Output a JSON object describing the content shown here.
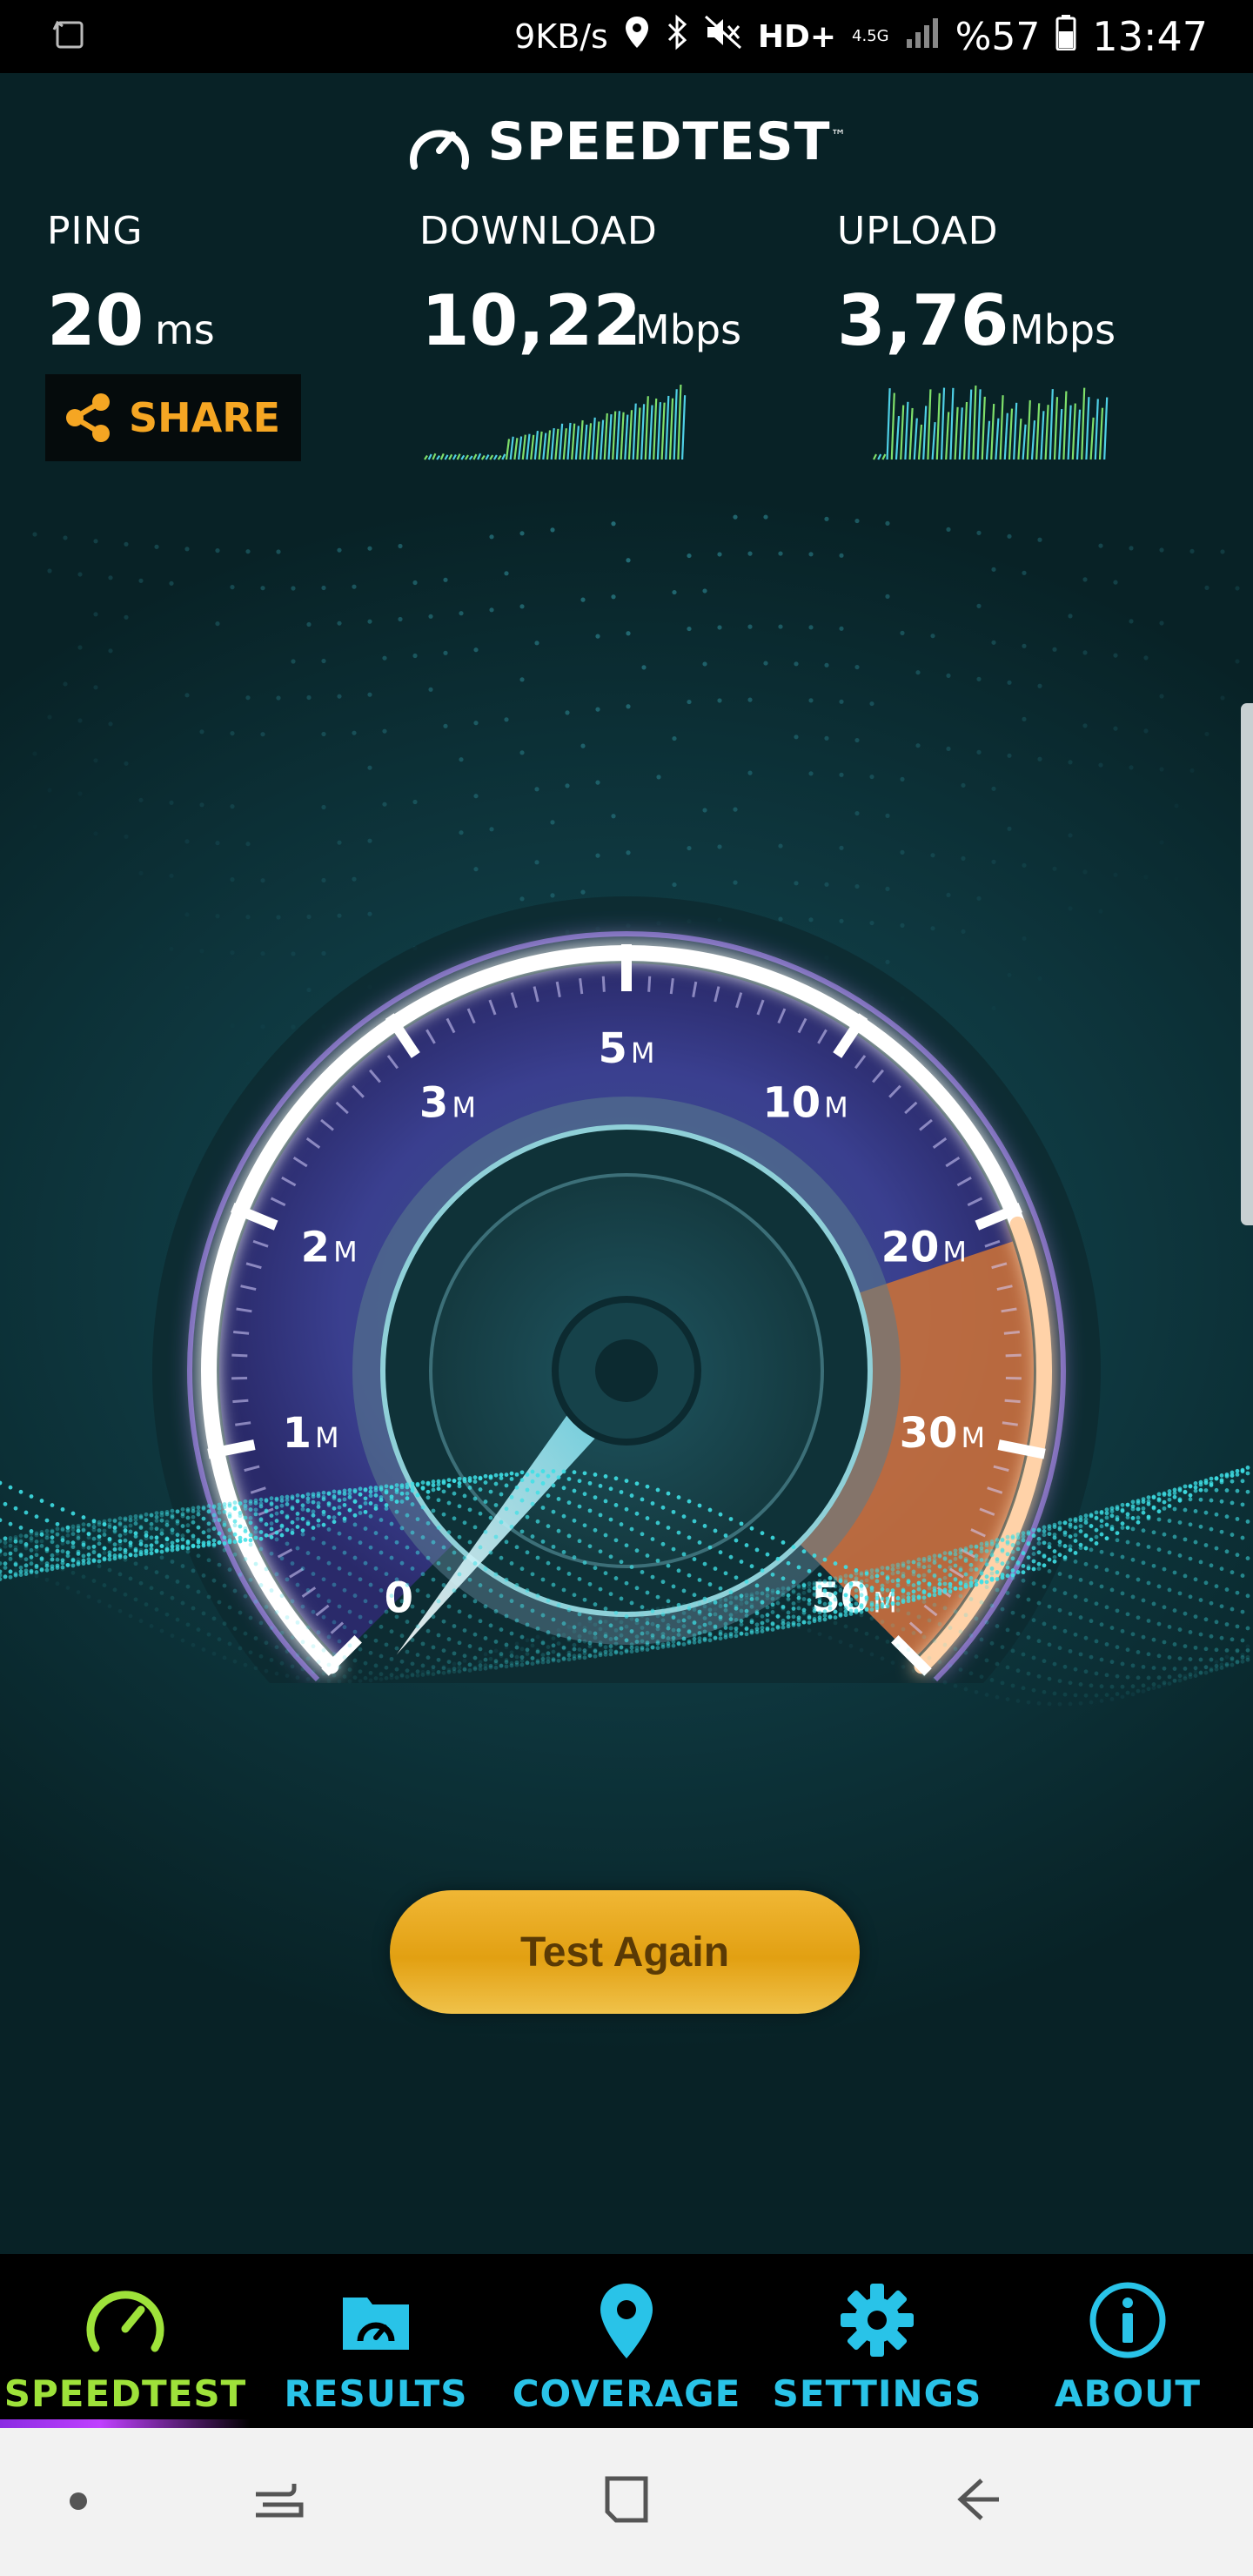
{
  "status_bar": {
    "speed": "9KB/s",
    "network": "HD+",
    "network_gen": "4.5G",
    "battery": "%57",
    "time": "13:47",
    "icons": [
      "screen-rotate-icon",
      "location-icon",
      "bluetooth-icon",
      "mute-icon",
      "signal-icon",
      "battery-icon"
    ]
  },
  "app": {
    "logo_text": "SPEEDTEST",
    "logo_tm": "™"
  },
  "metrics": {
    "ping": {
      "label": "PING",
      "value": "20",
      "unit": "ms"
    },
    "download": {
      "label": "DOWNLOAD",
      "value": "10,22",
      "unit": "Mbps"
    },
    "upload": {
      "label": "UPLOAD",
      "value": "3,76",
      "unit": "Mbps"
    }
  },
  "share": {
    "label": "SHARE",
    "icon": "share-icon"
  },
  "gauge": {
    "ticks": [
      {
        "num": "0",
        "unit": ""
      },
      {
        "num": "1",
        "unit": "M"
      },
      {
        "num": "2",
        "unit": "M"
      },
      {
        "num": "3",
        "unit": "M"
      },
      {
        "num": "5",
        "unit": "M"
      },
      {
        "num": "10",
        "unit": "M"
      },
      {
        "num": "20",
        "unit": "M"
      },
      {
        "num": "30",
        "unit": "M"
      },
      {
        "num": "50",
        "unit": "M"
      }
    ],
    "needle_value": 0,
    "colors": {
      "arc": "#ffffff",
      "glow": "#b48cff",
      "high_zone": "#e0803a",
      "needle": "#7fe3f0"
    }
  },
  "actions": {
    "test_again": "Test Again"
  },
  "tabs": [
    {
      "label": "SPEEDTEST",
      "icon": "speedometer-icon",
      "active": true
    },
    {
      "label": "RESULTS",
      "icon": "results-folder-icon",
      "active": false
    },
    {
      "label": "COVERAGE",
      "icon": "map-pin-icon",
      "active": false
    },
    {
      "label": "SETTINGS",
      "icon": "gear-icon",
      "active": false
    },
    {
      "label": "ABOUT",
      "icon": "info-icon",
      "active": false
    }
  ],
  "colors": {
    "accent_orange": "#f5a623",
    "tab_blue": "#29c3e8",
    "tab_active": "#9ee23a",
    "button_gold": "#e2a012"
  }
}
